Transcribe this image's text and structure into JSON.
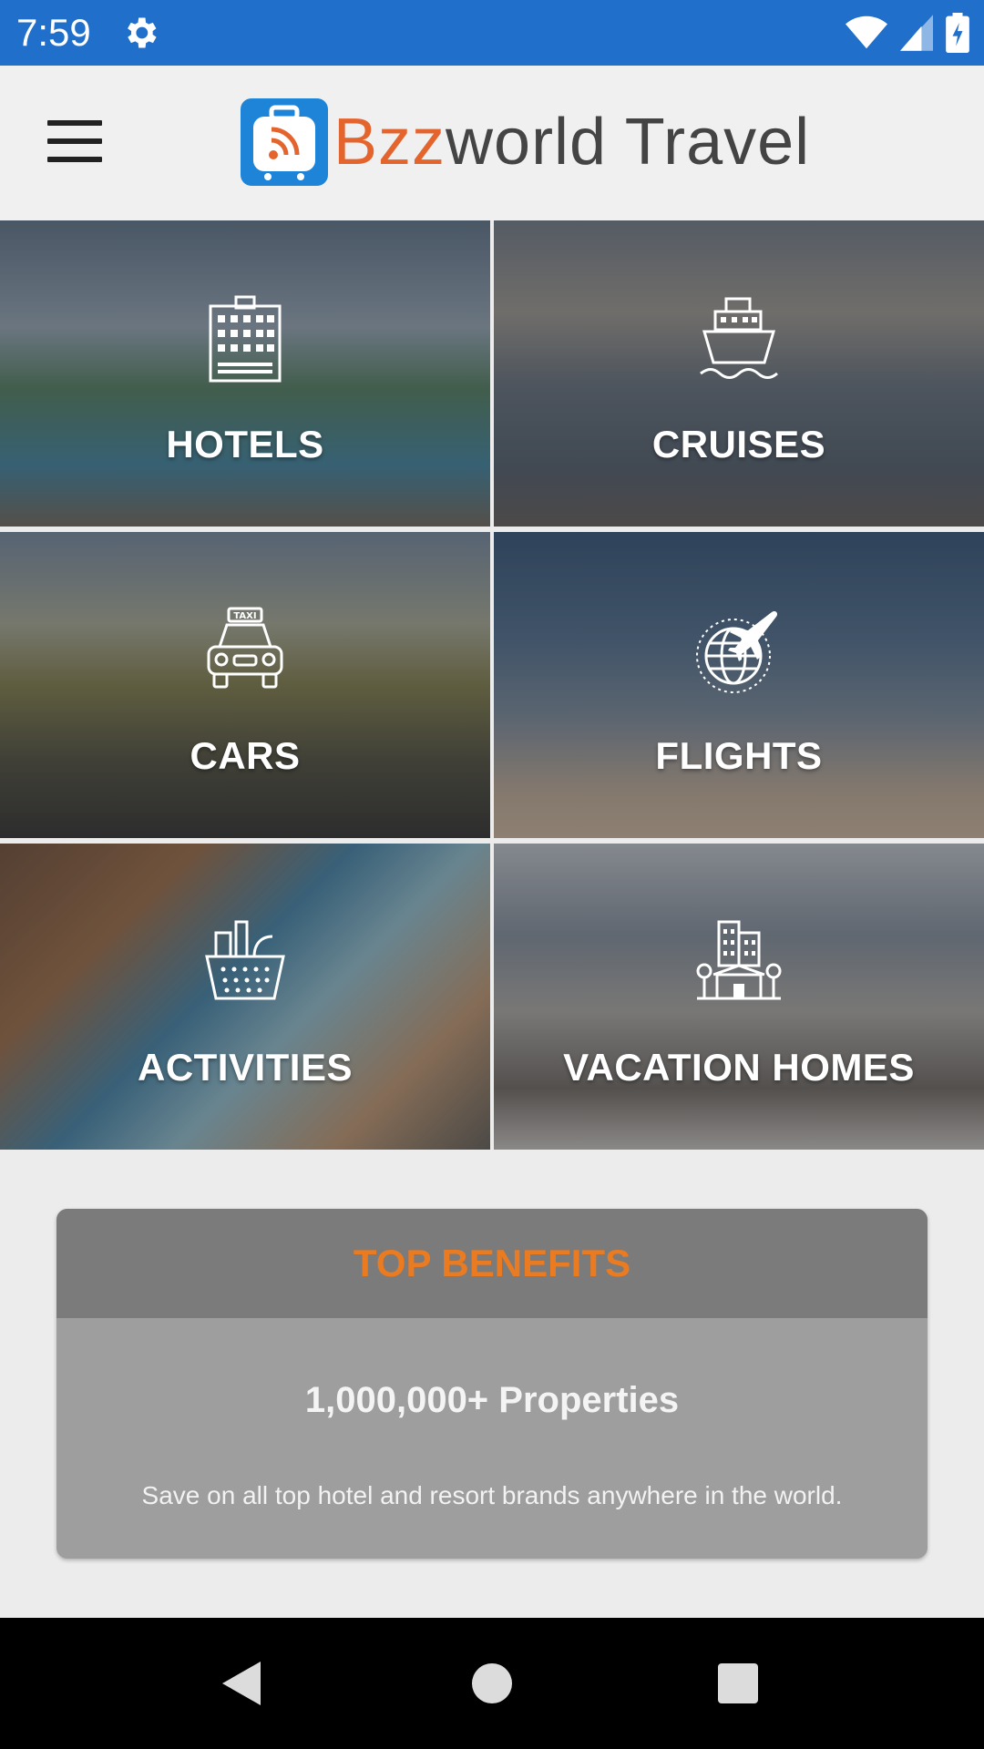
{
  "status_bar": {
    "time": "7:59",
    "icons": [
      "gear-icon",
      "wifi-icon",
      "signal-icon",
      "battery-charging-icon"
    ]
  },
  "app_bar": {
    "menu_icon": "hamburger-menu-icon",
    "logo": {
      "part1": "Bzz",
      "part2": "world Travel"
    }
  },
  "categories": [
    {
      "label": "HOTELS",
      "icon": "hotel-building-icon"
    },
    {
      "label": "CRUISES",
      "icon": "cruise-ship-icon"
    },
    {
      "label": "CARS",
      "icon": "taxi-car-icon"
    },
    {
      "label": "FLIGHTS",
      "icon": "globe-airplane-icon"
    },
    {
      "label": "ACTIVITIES",
      "icon": "picnic-basket-icon"
    },
    {
      "label": "VACATION HOMES",
      "icon": "city-house-icon"
    }
  ],
  "benefits": {
    "title": "TOP BENEFITS",
    "heading": "1,000,000+ Properties",
    "text": "Save on all top hotel and resort brands anywhere in the world."
  },
  "nav": [
    "back-icon",
    "home-icon",
    "recents-icon"
  ],
  "colors": {
    "status_bar": "#1f6fcb",
    "accent_orange": "#ea7b21",
    "logo_blue": "#1e84d8"
  }
}
